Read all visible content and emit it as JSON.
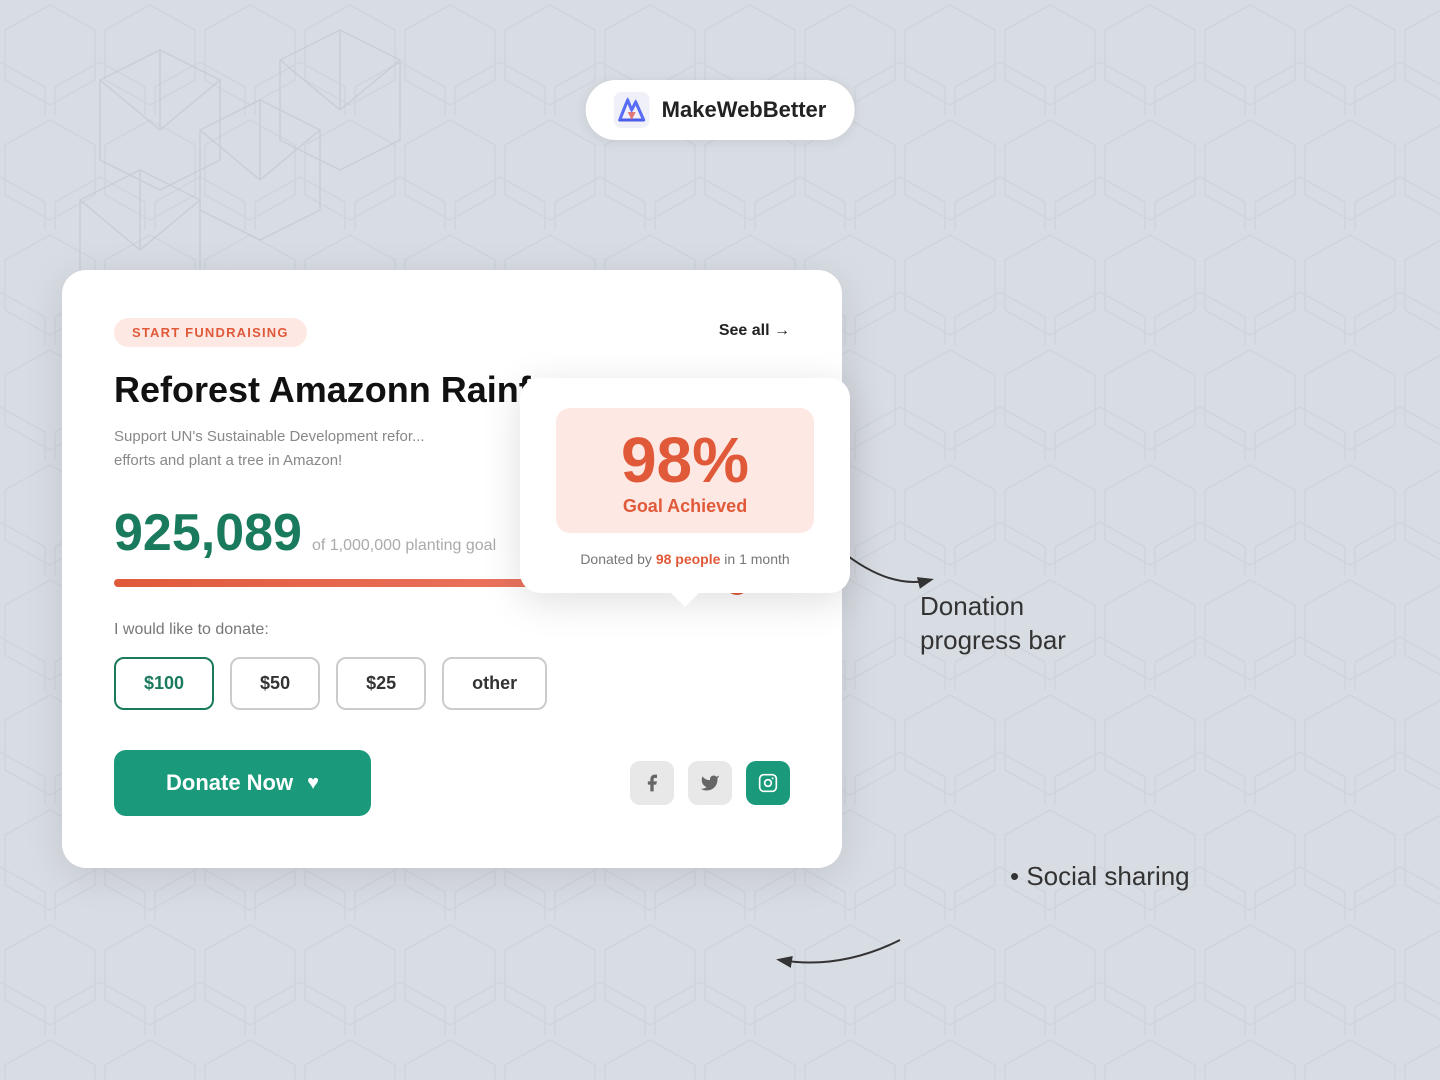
{
  "background_color": "#d8dce3",
  "logo": {
    "text": "MakeWebBetter"
  },
  "card": {
    "badge": "START FUNDRAISING",
    "see_all": "See all →",
    "title": "Reforest Amazonn Rainf",
    "description": "Support UN's Sustainable Development refor...\nefforts and plant a tree in Amazon!",
    "amount": "925,089",
    "goal": "of 1,000,000 planting goal",
    "progress_percent": 92.5,
    "donate_label": "I would like to donate:",
    "amount_buttons": [
      {
        "label": "$100",
        "active": true
      },
      {
        "label": "$50",
        "active": false
      },
      {
        "label": "$25",
        "active": false
      },
      {
        "label": "other",
        "active": false
      }
    ],
    "donate_button": "Donate Now",
    "social_icons": [
      "facebook",
      "twitter",
      "instagram"
    ]
  },
  "percent_card": {
    "percent": "98%",
    "label": "Goal Achieved",
    "donated_text_pre": "Donated by ",
    "donated_people": "98 people",
    "donated_text_post": " in 1 month"
  },
  "annotations": {
    "progress_bar": "Donation\nprogress bar",
    "social_sharing": "Social sharing"
  }
}
